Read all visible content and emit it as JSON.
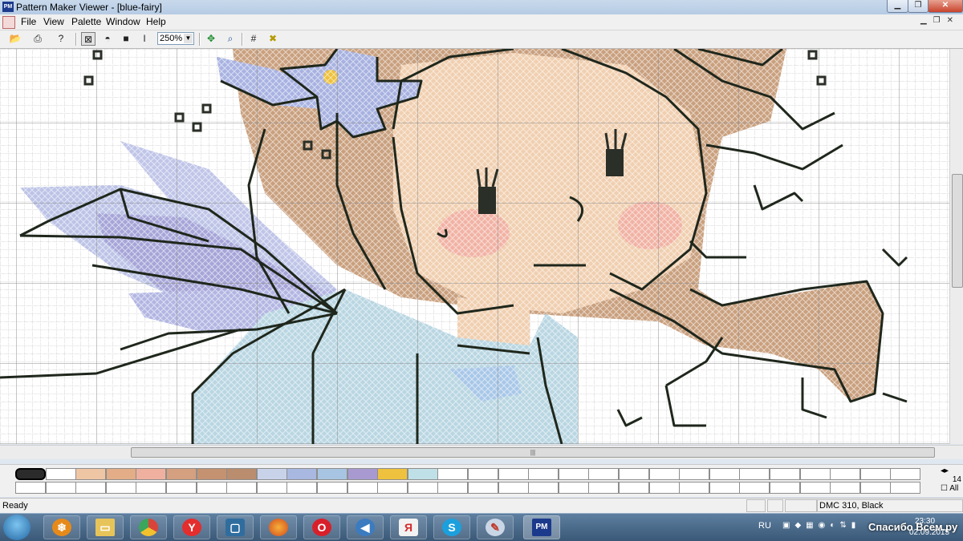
{
  "window": {
    "app_icon": "PM",
    "title": "Pattern Maker Viewer - [blue-fairy]",
    "controls": [
      "minimize-icon",
      "maximize-icon",
      "close-icon"
    ]
  },
  "menu": {
    "items": [
      "File",
      "View",
      "Palette",
      "Window",
      "Help"
    ]
  },
  "toolbar": {
    "buttons": [
      "open-icon",
      "print-icon",
      "help-icon",
      "full-stitch-icon",
      "half-stitch-icon",
      "symbol-icon",
      "text-cursor-icon",
      "fit-icon",
      "zoom-icon",
      "grid-icon",
      "stitch-x-icon"
    ],
    "zoom": "250%"
  },
  "palette": {
    "colors": [
      "#2b2b2b",
      "#ffffff",
      "#efc6a4",
      "#e2ad87",
      "#efb0a0",
      "#d4a07f",
      "#c49270",
      "#b98d6e",
      "#c8d3ea",
      "#a9b8e0",
      "#a7c5e2",
      "#a89ad0",
      "#eec13e",
      "#bfe0e6"
    ],
    "side_label": "14",
    "all_label": "All"
  },
  "status": {
    "ready": "Ready",
    "color_info": "DMC  310, Black"
  },
  "taskbar": {
    "lang": "RU",
    "time": "23:30",
    "date": "02.09.2015",
    "watermark": "Спасибо Всем.ру"
  },
  "colors": {
    "hair": "#c9a07e",
    "skin": "#f0cfb0",
    "cheek": "#f1b2a4",
    "dress": "#b9d6e2",
    "wing": "#bcc3e6",
    "outline": "#1f271c"
  }
}
